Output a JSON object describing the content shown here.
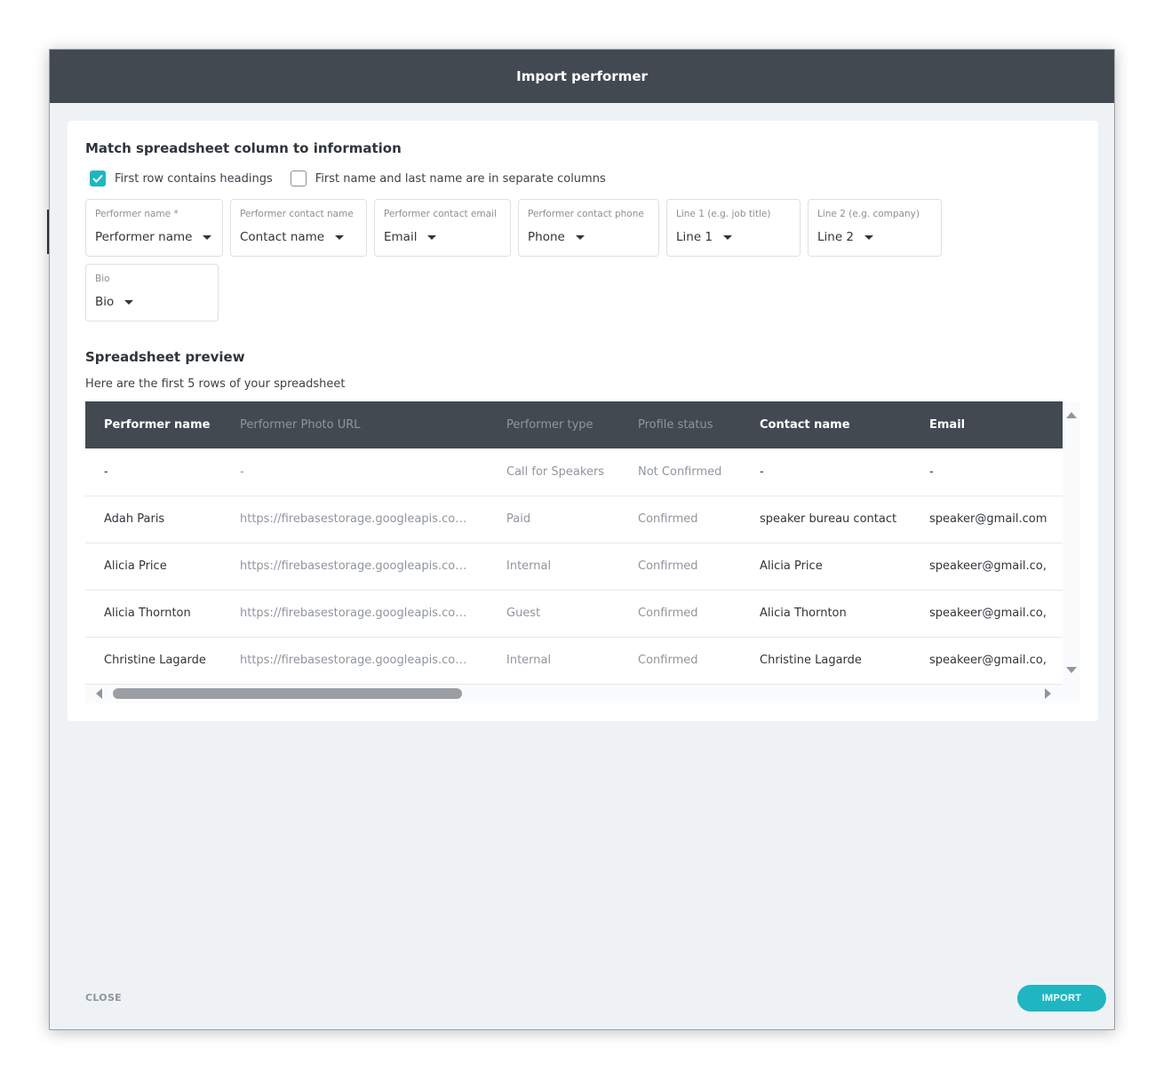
{
  "modal": {
    "title": "Import performer"
  },
  "match": {
    "title": "Match spreadsheet column to information",
    "checkbox_headings_label": "First row contains headings",
    "checkbox_headings_checked": true,
    "checkbox_split_label": "First name and last name are in separate columns",
    "checkbox_split_checked": false,
    "fields": [
      {
        "label": "Performer name *",
        "value": "Performer name"
      },
      {
        "label": "Performer contact name",
        "value": "Contact name"
      },
      {
        "label": "Performer contact email",
        "value": "Email"
      },
      {
        "label": "Performer contact phone",
        "value": "Phone"
      },
      {
        "label": "Line 1 (e.g. job title)",
        "value": "Line 1"
      },
      {
        "label": "Line 2 (e.g. company)",
        "value": "Line 2"
      },
      {
        "label": "Bio",
        "value": "Bio"
      }
    ]
  },
  "preview": {
    "title": "Spreadsheet preview",
    "subtitle": "Here are the first 5 rows of your spreadsheet",
    "columns": [
      "Performer name",
      "Performer Photo URL",
      "Performer type",
      "Profile status",
      "Contact name",
      "Email"
    ],
    "rows": [
      [
        "-",
        "-",
        "Call for Speakers",
        "Not Confirmed",
        "-",
        "-"
      ],
      [
        "Adah Paris",
        "https://firebasestorage.googleapis.co…",
        "Paid",
        "Confirmed",
        "speaker bureau contact",
        "speaker@gmail.com"
      ],
      [
        "Alicia Price",
        "https://firebasestorage.googleapis.co…",
        "Internal",
        "Confirmed",
        "Alicia Price",
        "speakeer@gmail.co,"
      ],
      [
        "Alicia Thornton",
        "https://firebasestorage.googleapis.co…",
        "Guest",
        "Confirmed",
        "Alicia Thornton",
        "speakeer@gmail.co,"
      ],
      [
        "Christine Lagarde",
        "https://firebasestorage.googleapis.co…",
        "Internal",
        "Confirmed",
        "Christine Lagarde",
        "speakeer@gmail.co,"
      ]
    ]
  },
  "footer": {
    "close_label": "CLOSE",
    "import_label": "IMPORT"
  },
  "colors": {
    "header_bg": "#424951",
    "accent": "#1fb6c1",
    "modal_bg": "#eff2f5"
  }
}
